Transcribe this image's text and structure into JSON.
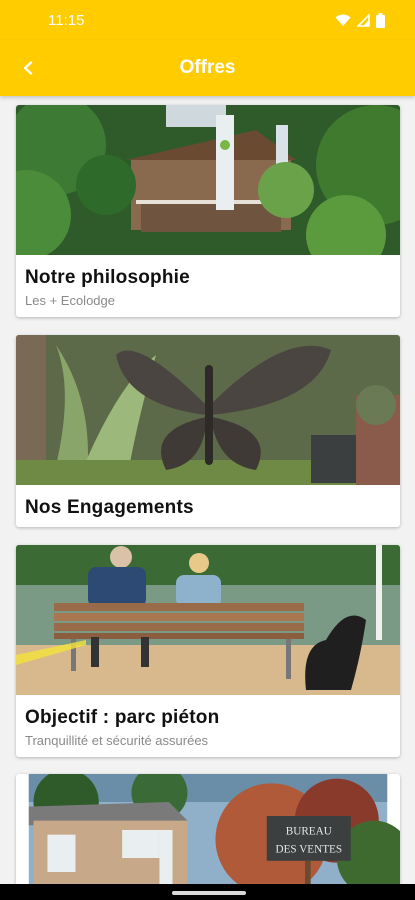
{
  "status_bar": {
    "time": "11:15"
  },
  "app_bar": {
    "title": "Offres",
    "back_icon": "chevron-left-icon"
  },
  "cards": [
    {
      "title": "Notre philosophie",
      "subtitle": "Les + Ecolodge"
    },
    {
      "title": "Nos Engagements"
    },
    {
      "title": "Objectif : parc piéton",
      "subtitle": "Tranquillité et sécurité assurées"
    },
    {
      "sign_line1": "BUREAU",
      "sign_line2": "DES VENTES"
    }
  ],
  "colors": {
    "accent": "#ffcc00",
    "card_bg": "#ffffff",
    "page_bg": "#f2f2f2"
  }
}
